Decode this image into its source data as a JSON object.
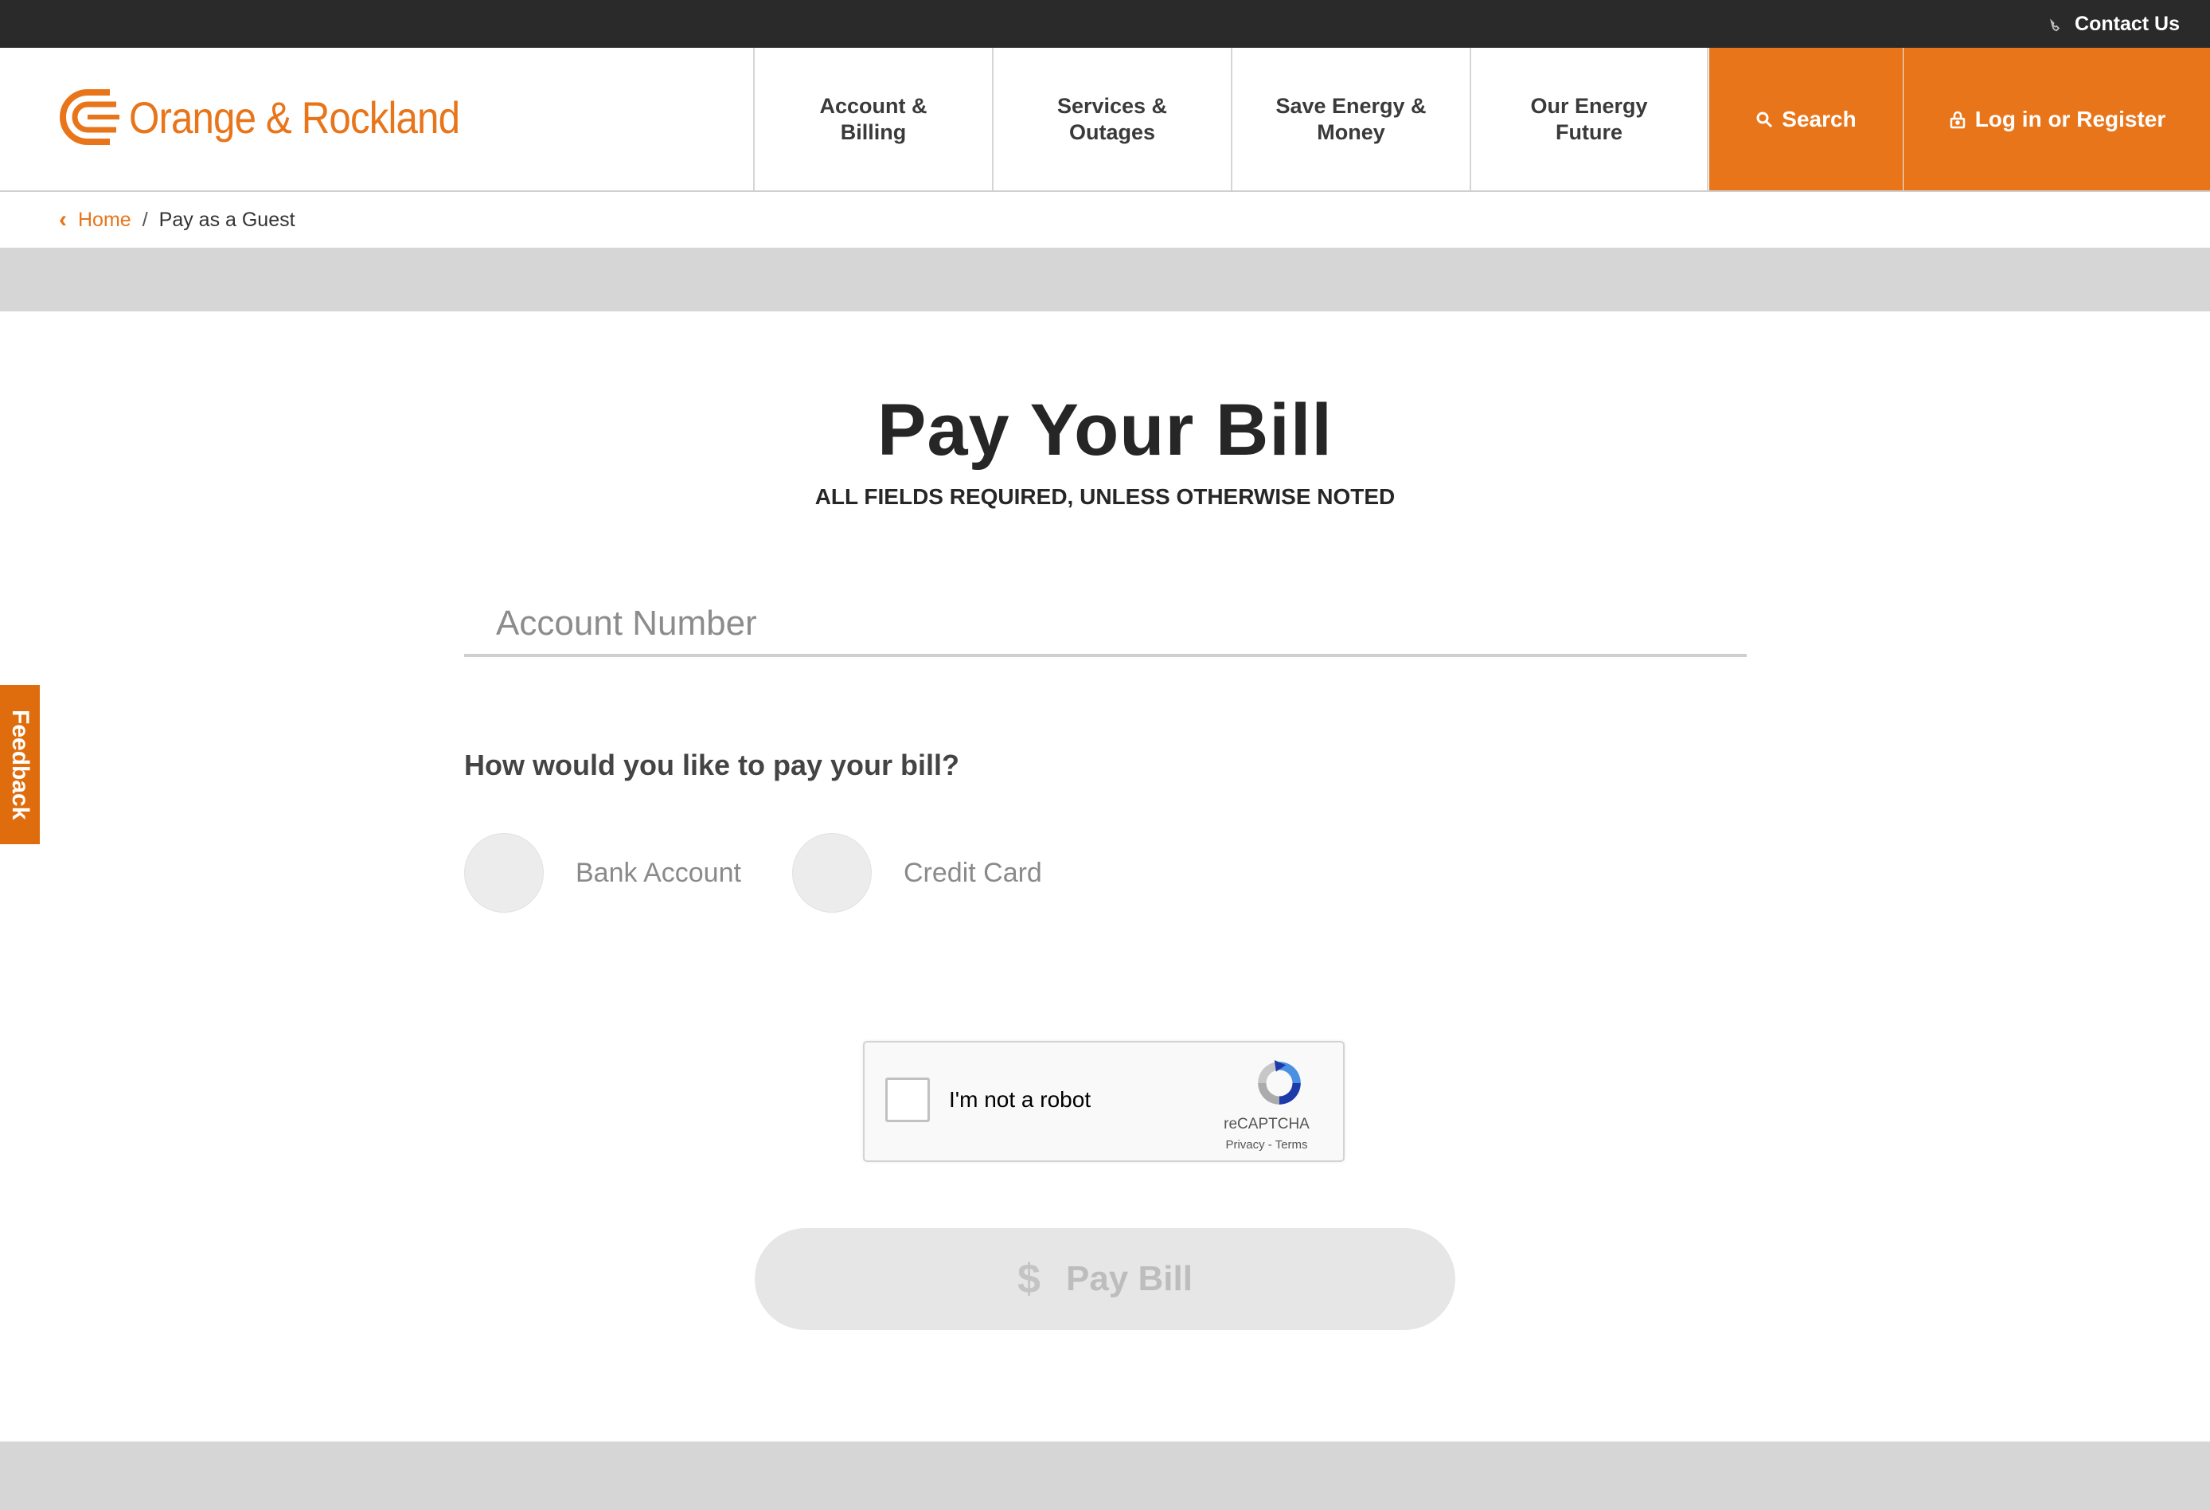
{
  "utility": {
    "contact_label": "Contact Us"
  },
  "brand": {
    "name": "Orange & Rockland",
    "color": "#e8751a"
  },
  "nav": {
    "items": [
      {
        "label": "Account &\nBilling"
      },
      {
        "label": "Services &\nOutages"
      },
      {
        "label": "Save Energy &\nMoney"
      },
      {
        "label": "Our Energy\nFuture"
      }
    ],
    "search_label": "Search",
    "login_label": "Log in or Register"
  },
  "breadcrumb": {
    "home": "Home",
    "separator": "/",
    "current": "Pay as a Guest"
  },
  "main": {
    "title": "Pay Your Bill",
    "subtitle": "ALL FIELDS REQUIRED, UNLESS OTHERWISE NOTED",
    "account_placeholder": "Account Number",
    "account_value": "",
    "pay_question": "How would you like to pay your bill?",
    "payment_options": [
      {
        "label": "Bank Account",
        "selected": false
      },
      {
        "label": "Credit Card",
        "selected": false
      }
    ]
  },
  "recaptcha": {
    "label": "I'm not a robot",
    "brand": "reCAPTCHA",
    "privacy": "Privacy",
    "link_separator": "-",
    "terms": "Terms",
    "checked": false
  },
  "pay_button": {
    "label": "Pay Bill",
    "icon": "dollar-icon",
    "enabled": false
  },
  "feedback": {
    "label": "Feedback"
  }
}
